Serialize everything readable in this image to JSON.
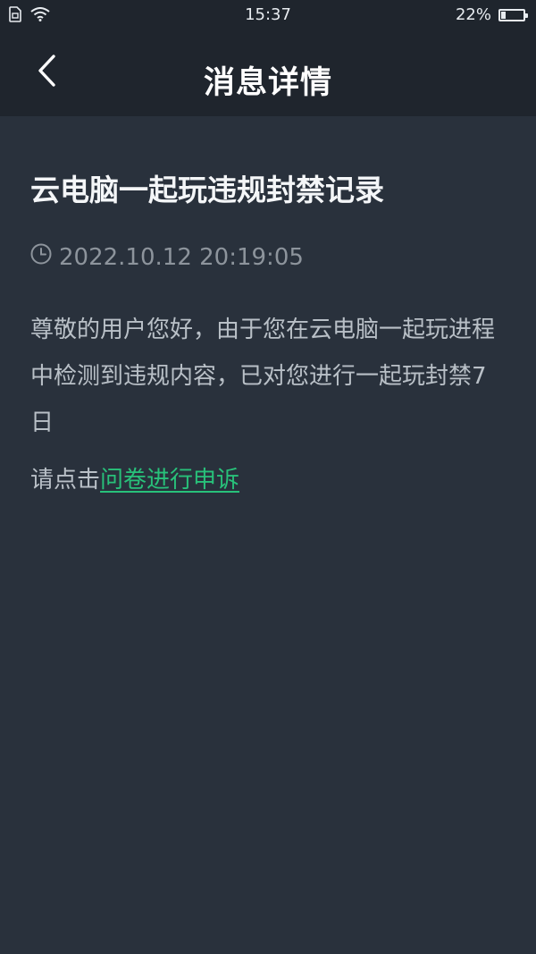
{
  "status_bar": {
    "time": "15:37",
    "battery_percent_text": "22%",
    "battery_level": 0.22,
    "icons": [
      "sim-card-icon",
      "wifi-icon",
      "battery-icon"
    ]
  },
  "nav": {
    "title": "消息详情",
    "back_icon": "chevron-left-icon"
  },
  "message": {
    "title": "云电脑一起玩违规封禁记录",
    "time_icon": "clock-icon",
    "timestamp": "2022.10.12 20:19:05",
    "body": "尊敬的用户您好，由于您在云电脑一起玩进程中检测到违规内容，已对您进行一起玩封禁7日",
    "appeal_prefix": "请点击",
    "appeal_link": "问卷进行申诉"
  },
  "colors": {
    "background": "#29313c",
    "header": "#1f252d",
    "link": "#28c17a"
  }
}
